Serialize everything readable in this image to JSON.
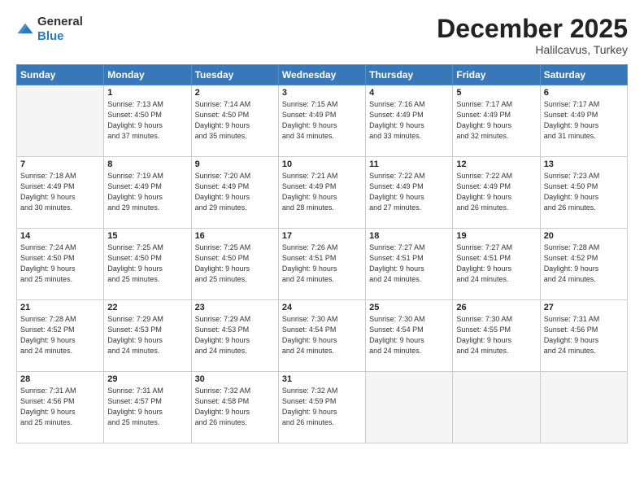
{
  "logo": {
    "general": "General",
    "blue": "Blue"
  },
  "header": {
    "month": "December 2025",
    "location": "Halilcavus, Turkey"
  },
  "weekdays": [
    "Sunday",
    "Monday",
    "Tuesday",
    "Wednesday",
    "Thursday",
    "Friday",
    "Saturday"
  ],
  "weeks": [
    [
      {
        "day": "",
        "info": ""
      },
      {
        "day": "1",
        "info": "Sunrise: 7:13 AM\nSunset: 4:50 PM\nDaylight: 9 hours\nand 37 minutes."
      },
      {
        "day": "2",
        "info": "Sunrise: 7:14 AM\nSunset: 4:50 PM\nDaylight: 9 hours\nand 35 minutes."
      },
      {
        "day": "3",
        "info": "Sunrise: 7:15 AM\nSunset: 4:49 PM\nDaylight: 9 hours\nand 34 minutes."
      },
      {
        "day": "4",
        "info": "Sunrise: 7:16 AM\nSunset: 4:49 PM\nDaylight: 9 hours\nand 33 minutes."
      },
      {
        "day": "5",
        "info": "Sunrise: 7:17 AM\nSunset: 4:49 PM\nDaylight: 9 hours\nand 32 minutes."
      },
      {
        "day": "6",
        "info": "Sunrise: 7:17 AM\nSunset: 4:49 PM\nDaylight: 9 hours\nand 31 minutes."
      }
    ],
    [
      {
        "day": "7",
        "info": "Sunrise: 7:18 AM\nSunset: 4:49 PM\nDaylight: 9 hours\nand 30 minutes."
      },
      {
        "day": "8",
        "info": "Sunrise: 7:19 AM\nSunset: 4:49 PM\nDaylight: 9 hours\nand 29 minutes."
      },
      {
        "day": "9",
        "info": "Sunrise: 7:20 AM\nSunset: 4:49 PM\nDaylight: 9 hours\nand 29 minutes."
      },
      {
        "day": "10",
        "info": "Sunrise: 7:21 AM\nSunset: 4:49 PM\nDaylight: 9 hours\nand 28 minutes."
      },
      {
        "day": "11",
        "info": "Sunrise: 7:22 AM\nSunset: 4:49 PM\nDaylight: 9 hours\nand 27 minutes."
      },
      {
        "day": "12",
        "info": "Sunrise: 7:22 AM\nSunset: 4:49 PM\nDaylight: 9 hours\nand 26 minutes."
      },
      {
        "day": "13",
        "info": "Sunrise: 7:23 AM\nSunset: 4:50 PM\nDaylight: 9 hours\nand 26 minutes."
      }
    ],
    [
      {
        "day": "14",
        "info": "Sunrise: 7:24 AM\nSunset: 4:50 PM\nDaylight: 9 hours\nand 25 minutes."
      },
      {
        "day": "15",
        "info": "Sunrise: 7:25 AM\nSunset: 4:50 PM\nDaylight: 9 hours\nand 25 minutes."
      },
      {
        "day": "16",
        "info": "Sunrise: 7:25 AM\nSunset: 4:50 PM\nDaylight: 9 hours\nand 25 minutes."
      },
      {
        "day": "17",
        "info": "Sunrise: 7:26 AM\nSunset: 4:51 PM\nDaylight: 9 hours\nand 24 minutes."
      },
      {
        "day": "18",
        "info": "Sunrise: 7:27 AM\nSunset: 4:51 PM\nDaylight: 9 hours\nand 24 minutes."
      },
      {
        "day": "19",
        "info": "Sunrise: 7:27 AM\nSunset: 4:51 PM\nDaylight: 9 hours\nand 24 minutes."
      },
      {
        "day": "20",
        "info": "Sunrise: 7:28 AM\nSunset: 4:52 PM\nDaylight: 9 hours\nand 24 minutes."
      }
    ],
    [
      {
        "day": "21",
        "info": "Sunrise: 7:28 AM\nSunset: 4:52 PM\nDaylight: 9 hours\nand 24 minutes."
      },
      {
        "day": "22",
        "info": "Sunrise: 7:29 AM\nSunset: 4:53 PM\nDaylight: 9 hours\nand 24 minutes."
      },
      {
        "day": "23",
        "info": "Sunrise: 7:29 AM\nSunset: 4:53 PM\nDaylight: 9 hours\nand 24 minutes."
      },
      {
        "day": "24",
        "info": "Sunrise: 7:30 AM\nSunset: 4:54 PM\nDaylight: 9 hours\nand 24 minutes."
      },
      {
        "day": "25",
        "info": "Sunrise: 7:30 AM\nSunset: 4:54 PM\nDaylight: 9 hours\nand 24 minutes."
      },
      {
        "day": "26",
        "info": "Sunrise: 7:30 AM\nSunset: 4:55 PM\nDaylight: 9 hours\nand 24 minutes."
      },
      {
        "day": "27",
        "info": "Sunrise: 7:31 AM\nSunset: 4:56 PM\nDaylight: 9 hours\nand 24 minutes."
      }
    ],
    [
      {
        "day": "28",
        "info": "Sunrise: 7:31 AM\nSunset: 4:56 PM\nDaylight: 9 hours\nand 25 minutes."
      },
      {
        "day": "29",
        "info": "Sunrise: 7:31 AM\nSunset: 4:57 PM\nDaylight: 9 hours\nand 25 minutes."
      },
      {
        "day": "30",
        "info": "Sunrise: 7:32 AM\nSunset: 4:58 PM\nDaylight: 9 hours\nand 26 minutes."
      },
      {
        "day": "31",
        "info": "Sunrise: 7:32 AM\nSunset: 4:59 PM\nDaylight: 9 hours\nand 26 minutes."
      },
      {
        "day": "",
        "info": ""
      },
      {
        "day": "",
        "info": ""
      },
      {
        "day": "",
        "info": ""
      }
    ]
  ]
}
